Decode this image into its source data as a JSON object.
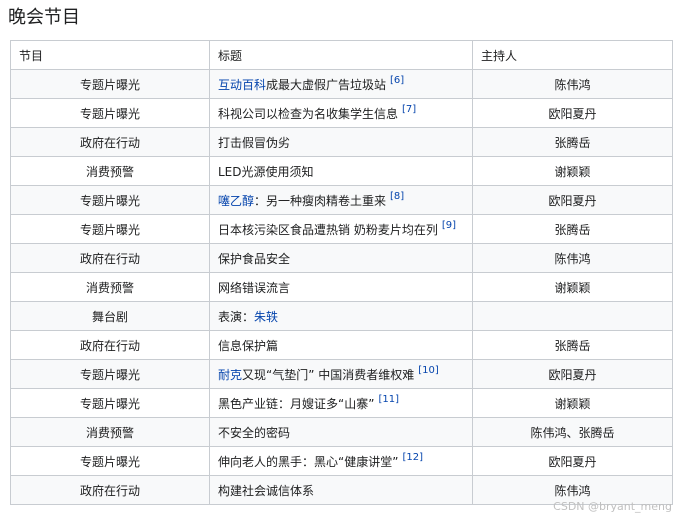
{
  "page_title": "晚会节目",
  "table": {
    "headers": [
      "节目",
      "标题",
      "主持人"
    ],
    "rows": [
      {
        "program": "专题片曝光",
        "title_link": "互动百科",
        "title": "成最大虚假广告垃圾站",
        "ref": "[6]",
        "host": "陈伟鸿"
      },
      {
        "program": "专题片曝光",
        "title_link": "",
        "title": "科视公司以检查为名收集学生信息",
        "ref": "[7]",
        "host": "欧阳夏丹"
      },
      {
        "program": "政府在行动",
        "title_link": "",
        "title": "打击假冒伪劣",
        "ref": "",
        "host": "张腾岳"
      },
      {
        "program": "消费预警",
        "title_link": "",
        "title": "LED光源使用须知",
        "ref": "",
        "host": "谢颖颖"
      },
      {
        "program": "专题片曝光",
        "title_link": "噻乙醇",
        "title": "：另一种瘦肉精卷土重来",
        "ref": "[8]",
        "host": "欧阳夏丹"
      },
      {
        "program": "专题片曝光",
        "title_link": "",
        "title": "日本核污染区食品遭热销 奶粉麦片均在列",
        "ref": "[9]",
        "host": "张腾岳"
      },
      {
        "program": "政府在行动",
        "title_link": "",
        "title": "保护食品安全",
        "ref": "",
        "host": "陈伟鸿"
      },
      {
        "program": "消费预警",
        "title_link": "",
        "title": "网络错误流言",
        "ref": "",
        "host": "谢颖颖"
      },
      {
        "program": "舞台剧",
        "title_link": "",
        "title": "表演：",
        "title_link_after": "朱轶",
        "ref": "",
        "host": ""
      },
      {
        "program": "政府在行动",
        "title_link": "",
        "title": "信息保护篇",
        "ref": "",
        "host": "张腾岳"
      },
      {
        "program": "专题片曝光",
        "title_link": "耐克",
        "title": "又现“气垫门” 中国消费者维权难",
        "ref": "[10]",
        "host": "欧阳夏丹"
      },
      {
        "program": "专题片曝光",
        "title_link": "",
        "title": "黑色产业链：月嫂证多“山寨”",
        "ref": "[11]",
        "host": "谢颖颖"
      },
      {
        "program": "消费预警",
        "title_link": "",
        "title": "不安全的密码",
        "ref": "",
        "host": "陈伟鸿、张腾岳"
      },
      {
        "program": "专题片曝光",
        "title_link": "",
        "title": "伸向老人的黑手：黑心“健康讲堂”",
        "ref": "[12]",
        "host": "欧阳夏丹"
      },
      {
        "program": "政府在行动",
        "title_link": "",
        "title": "构建社会诚信体系",
        "ref": "",
        "host": "陈伟鸿"
      }
    ]
  },
  "watermark": "CSDN @bryant_meng"
}
